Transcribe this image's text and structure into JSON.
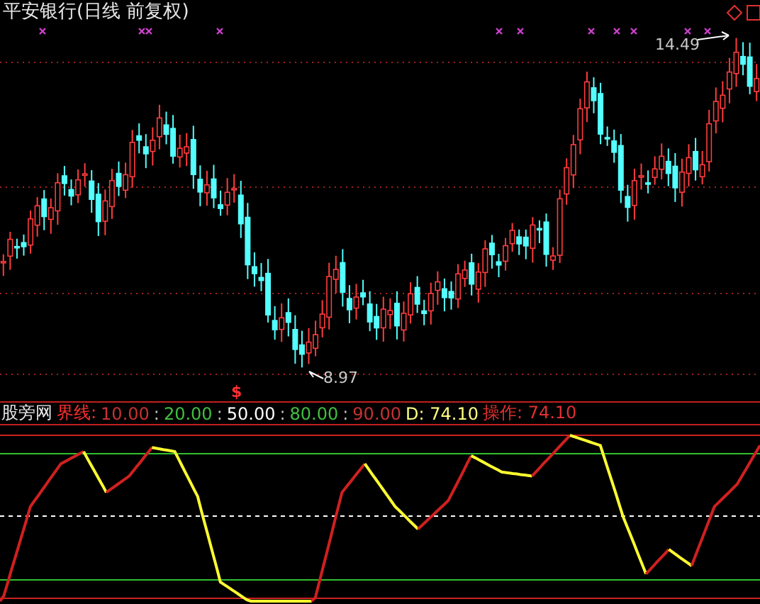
{
  "title": "平安银行(日线 前复权)",
  "high_label": "14.49",
  "low_label": "8.97",
  "signal_mark": "$",
  "indicator": {
    "name": "股旁网",
    "segments": [
      {
        "text": "界线:",
        "kind": "label"
      },
      {
        "text": "10.00",
        "kind": "outer"
      },
      {
        "text": ":",
        "kind": "separator"
      },
      {
        "text": "20.00",
        "kind": "inner"
      },
      {
        "text": ":",
        "kind": "separator"
      },
      {
        "text": "50.00",
        "kind": "middle"
      },
      {
        "text": ":",
        "kind": "separator"
      },
      {
        "text": "80.00",
        "kind": "inner"
      },
      {
        "text": ":",
        "kind": "separator"
      },
      {
        "text": "90.00",
        "kind": "outer"
      },
      {
        "text": "D: 74.10",
        "kind": "value"
      },
      {
        "text": "操作: 74.10",
        "kind": "signal"
      }
    ]
  }
}
